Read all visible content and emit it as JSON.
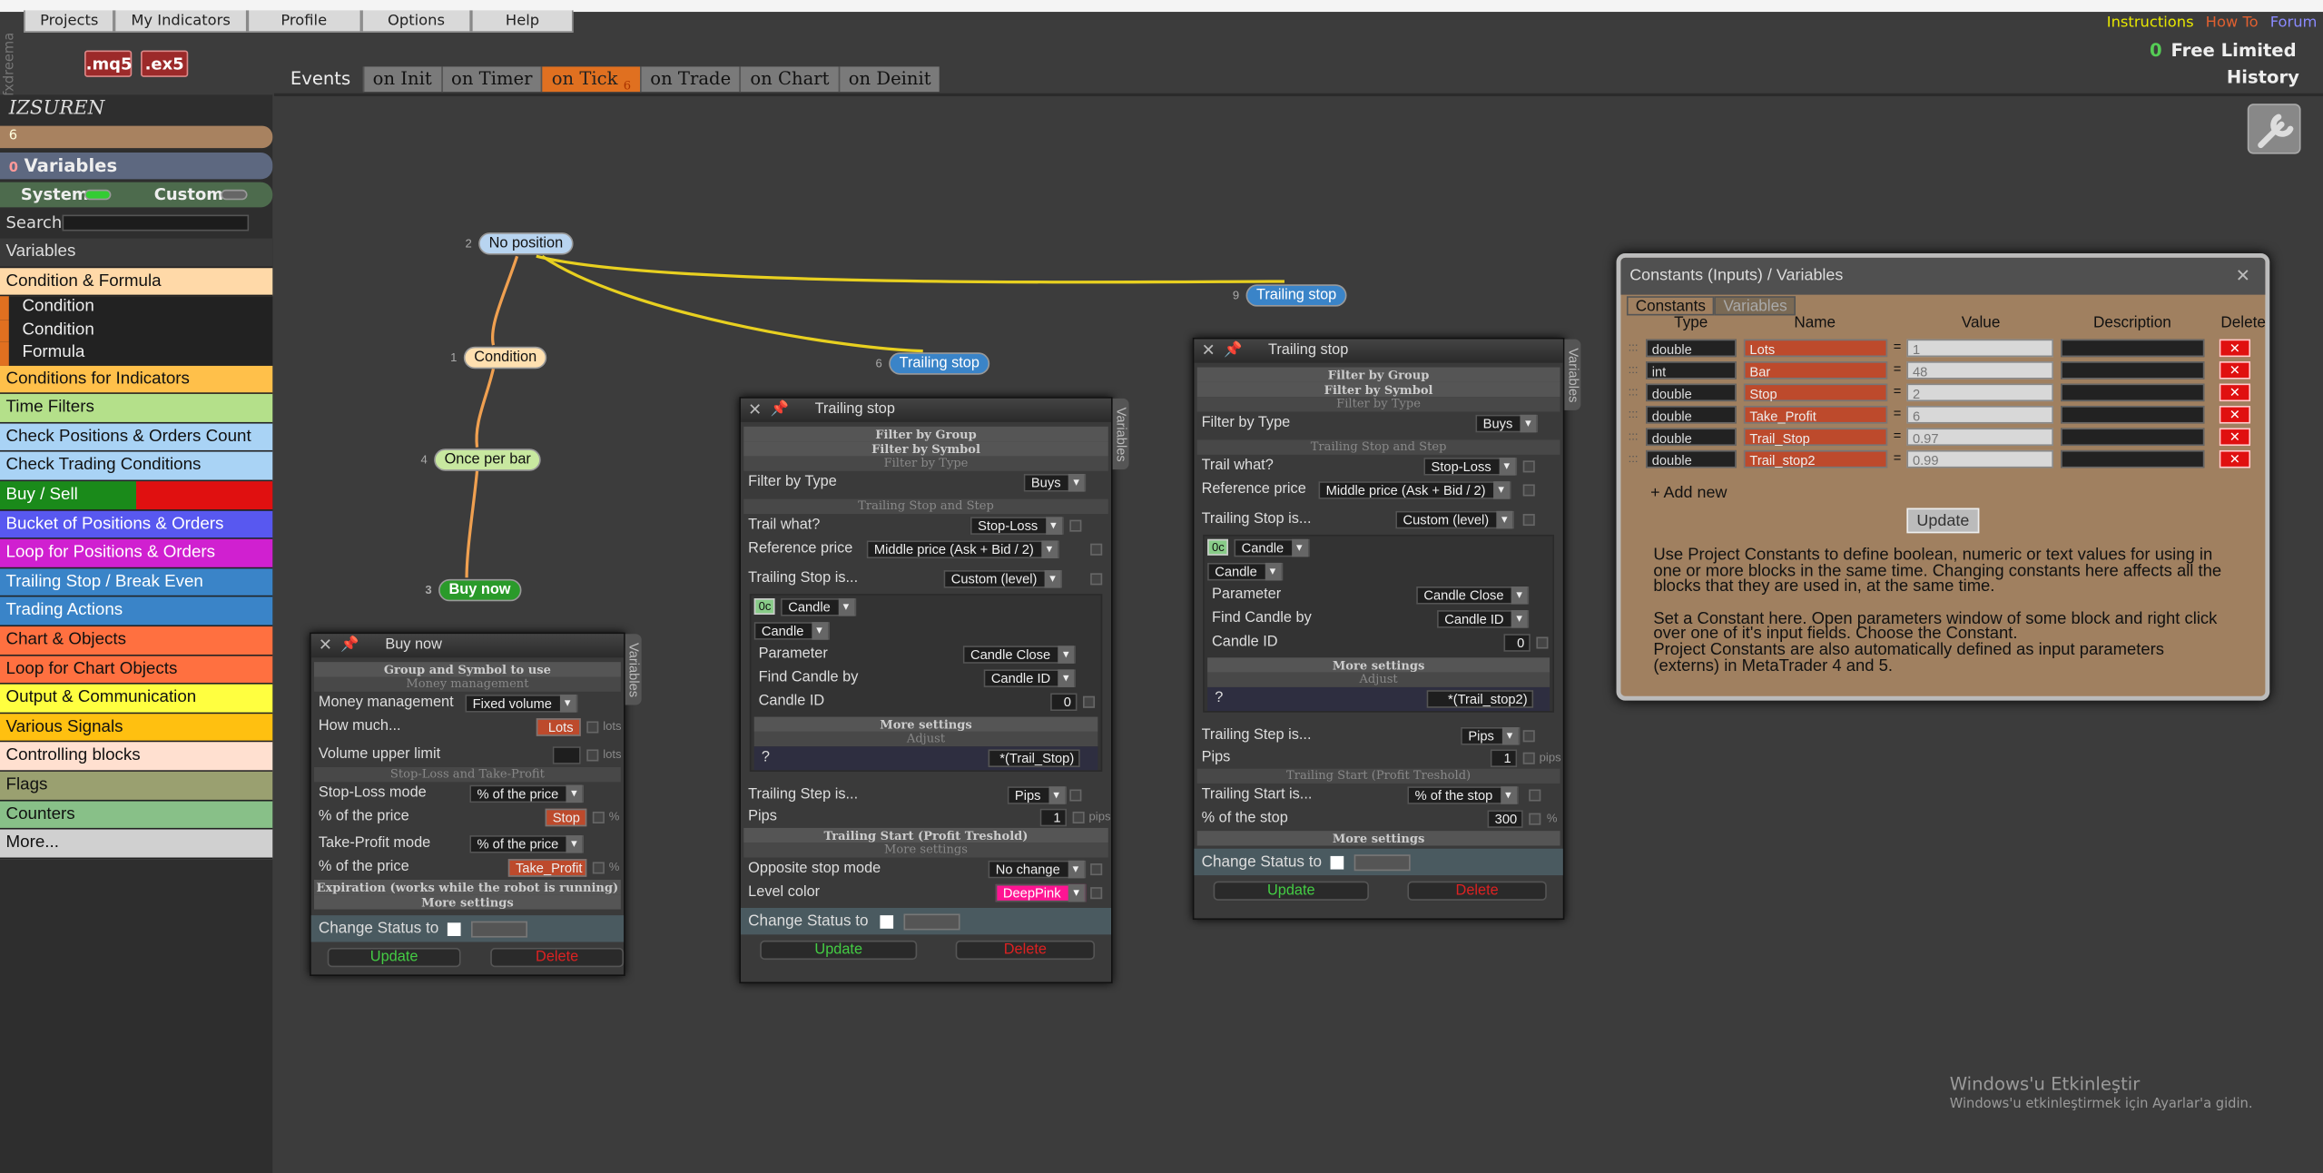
{
  "menu": [
    "Projects",
    "My Indicators",
    "Profile",
    "Options",
    "Help"
  ],
  "brand": "fxdreema",
  "file_buttons": [
    ".mq5",
    ".ex5"
  ],
  "top_links": {
    "instructions": "Instructions",
    "howto": "How To",
    "forum": "Forum",
    "colors": {
      "instructions": "#e8e800",
      "howto": "#e06030",
      "forum": "#8a8aff"
    }
  },
  "plan": {
    "count": "0",
    "label": "Free Limited"
  },
  "history": "History",
  "events": {
    "label": "Events",
    "tabs": [
      "on Init",
      "on Timer",
      "on Tick",
      "on Trade",
      "on Chart",
      "on Deinit"
    ],
    "active": "on Tick",
    "active_count": "6"
  },
  "project": {
    "name": "IZSUREN",
    "counter": "6",
    "variables_count": "0",
    "variables_label": "Variables"
  },
  "toggle": {
    "system": "System",
    "custom": "Custom"
  },
  "search_label": "Search:",
  "categories": [
    {
      "label": "Variables",
      "color": "#3a3a3a",
      "text": "#ddd"
    },
    {
      "label": "Condition & Formula",
      "color": "#ffd9a8",
      "text": "#111"
    },
    {
      "label": "Condition",
      "sub": true
    },
    {
      "label": "Condition",
      "sub": true
    },
    {
      "label": "Formula",
      "sub": true
    },
    {
      "label": "Conditions for Indicators",
      "color": "#ffc04a",
      "text": "#111"
    },
    {
      "label": "Time Filters",
      "color": "#b4e08a",
      "text": "#111"
    },
    {
      "label": "Check Positions & Orders Count",
      "color": "#a9d3f5",
      "text": "#111"
    },
    {
      "label": "Check Trading Conditions",
      "color": "#a9d3f5",
      "text": "#111"
    },
    {
      "label": "Buy / Sell",
      "color": "split",
      "text": "#fff"
    },
    {
      "label": "Bucket of Positions & Orders",
      "color": "#5858f0",
      "text": "#fff"
    },
    {
      "label": "Loop for Positions & Orders",
      "color": "#d020d0",
      "text": "#fff"
    },
    {
      "label": "Trailing Stop / Break Even",
      "color": "#3a84c8",
      "text": "#fff"
    },
    {
      "label": "Trading Actions",
      "color": "#3a84c8",
      "text": "#fff"
    },
    {
      "label": "Chart & Objects",
      "color": "#ff7040",
      "text": "#111"
    },
    {
      "label": "Loop for Chart Objects",
      "color": "#ff7040",
      "text": "#111"
    },
    {
      "label": "Output & Communication",
      "color": "#ffff40",
      "text": "#111"
    },
    {
      "label": "Various Signals",
      "color": "#ffc010",
      "text": "#111"
    },
    {
      "label": "Controlling blocks",
      "color": "#ffe0d0",
      "text": "#111"
    },
    {
      "label": "Flags",
      "color": "#9aa070",
      "text": "#111"
    },
    {
      "label": "Counters",
      "color": "#88c088",
      "text": "#111"
    },
    {
      "label": "More...",
      "color": "#d0d0d0",
      "text": "#111"
    }
  ],
  "nodes": [
    {
      "num": "2",
      "label": "No position",
      "color": "#b8d4f0"
    },
    {
      "num": "1",
      "label": "Condition",
      "color": "#ffe0b0"
    },
    {
      "num": "4",
      "label": "Once per bar",
      "color": "#c8e8a0"
    },
    {
      "num": "3",
      "label": "Buy now",
      "color": "#2a9a2a"
    },
    {
      "num": "6",
      "label": "Trailing stop",
      "color": "#3a84c8"
    },
    {
      "num": "9",
      "label": "Trailing stop",
      "color": "#3a84c8"
    }
  ],
  "buy_block": {
    "title": "Buy now",
    "vtab": "Variables",
    "sections": {
      "group": "Group and Symbol to use",
      "mm": "Money management",
      "sltp": "Stop-Loss and Take-Profit",
      "exp": "Expiration (works while the robot is running)",
      "more": "More settings"
    },
    "money_mgmt_label": "Money management",
    "money_mgmt_value": "Fixed volume",
    "how_much_label": "How much...",
    "how_much_value": "Lots",
    "lots_unit": "lots",
    "vol_label": "Volume upper limit",
    "sl_mode_label": "Stop-Loss mode",
    "sl_mode_value": "% of the price",
    "sl_pct_label": "% of the price",
    "sl_pct_value": "Stop",
    "pct_unit": "%",
    "tp_mode_label": "Take-Profit mode",
    "tp_mode_value": "% of the price",
    "tp_pct_label": "% of the price",
    "tp_pct_value": "Take_Profit",
    "status_label": "Change Status to",
    "update": "Update",
    "delete": "Delete"
  },
  "trail_block": {
    "title": "Trailing stop",
    "vtab": "Variables",
    "sec_group": "Filter by Group",
    "sec_symbol": "Filter by Symbol",
    "sec_type": "Filter by Type",
    "filter_label": "Filter by Type",
    "filter_value": "Buys",
    "sec_trail": "Trailing Stop and Step",
    "trail_what_label": "Trail what?",
    "trail_what_value": "Stop-Loss",
    "ref_label": "Reference price",
    "ref_value": "Middle price (Ask + Bid / 2)",
    "ts_is_label": "Trailing Stop is...",
    "ts_is_value": "Custom (level)",
    "candle_label": "Candle",
    "candle2": "Candle",
    "param_label": "Parameter",
    "param_value": "Candle Close",
    "find_label": "Find Candle by",
    "find_value": "Candle ID",
    "cid_label": "Candle ID",
    "cid_value": "0",
    "more": "More settings",
    "adjust": "Adjust",
    "q": "?",
    "tstep_label": "Trailing Step is...",
    "tstep_value": "Pips",
    "pips_label": "Pips",
    "pips_value": "1",
    "pips_unit": "pips",
    "sec_start": "Trailing Start (Profit Treshold)",
    "status_label": "Change Status to",
    "update": "Update",
    "delete": "Delete"
  },
  "trail_a": {
    "adjust_value": "*(Trail_Stop)",
    "more2": "More settings",
    "opp_label": "Opposite stop mode",
    "opp_value": "No change",
    "level_label": "Level color",
    "level_value": "DeepPink"
  },
  "trail_b": {
    "adjust_value": "*(Trail_stop2)",
    "tstart_label": "Trailing Start is...",
    "tstart_value": "% of the stop",
    "stop_pct_label": "% of the stop",
    "stop_pct_value": "300",
    "pct_unit": "%",
    "more2": "More settings"
  },
  "constants": {
    "title": "Constants (Inputs) / Variables",
    "tabs": [
      "Constants",
      "Variables"
    ],
    "headers": [
      "Type",
      "Name",
      "Value",
      "Description",
      "Delete"
    ],
    "rows": [
      {
        "type": "double",
        "name": "Lots",
        "value": "1"
      },
      {
        "type": "int",
        "name": "Bar",
        "value": "48"
      },
      {
        "type": "double",
        "name": "Stop",
        "value": "2"
      },
      {
        "type": "double",
        "name": "Take_Profit",
        "value": "6"
      },
      {
        "type": "double",
        "name": "Trail_Stop",
        "value": "0.97"
      },
      {
        "type": "double",
        "name": "Trail_stop2",
        "value": "0.99"
      }
    ],
    "add_new": "+ Add new",
    "update": "Update",
    "help1": "Use Project Constants to define boolean, numeric or text values for using in one or more blocks in the same time. Changing constants here affects all the blocks that they are used in, at the same time.",
    "help2": "Set a Constant here. Open parameters window of some block and right click over one of it's input fields. Choose the Constant.",
    "help3": "Project Constants are also automatically defined as input parameters (externs) in MetaTrader 4 and 5."
  },
  "watermark": {
    "line1": "Windows'u Etkinleştir",
    "line2": "Windows'u etkinleştirmek için Ayarlar'a gidin."
  }
}
